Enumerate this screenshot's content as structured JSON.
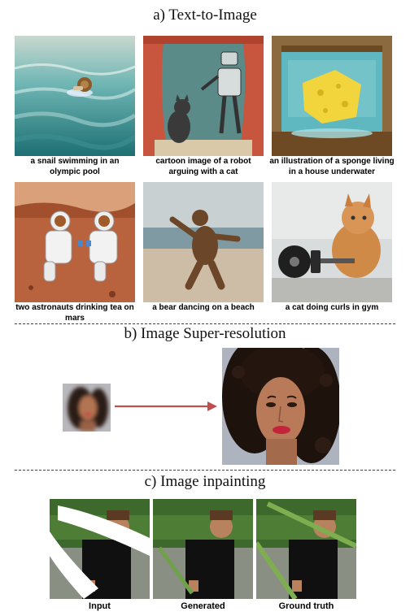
{
  "section_a": {
    "title": "a) Text-to-Image",
    "captions": [
      "a snail swimming in an olympic pool",
      "cartoon image of a robot arguing with a cat",
      "an illustration of a sponge living in a house underwater",
      "two astronauts drinking tea on mars",
      "a bear dancing on a beach",
      "a cat doing curls in gym"
    ]
  },
  "section_b": {
    "title": "b) Image Super-resolution",
    "arrow_color": "#c0504d"
  },
  "section_c": {
    "title": "c) Image inpainting",
    "labels": [
      "Input",
      "Generated",
      "Ground truth"
    ]
  }
}
